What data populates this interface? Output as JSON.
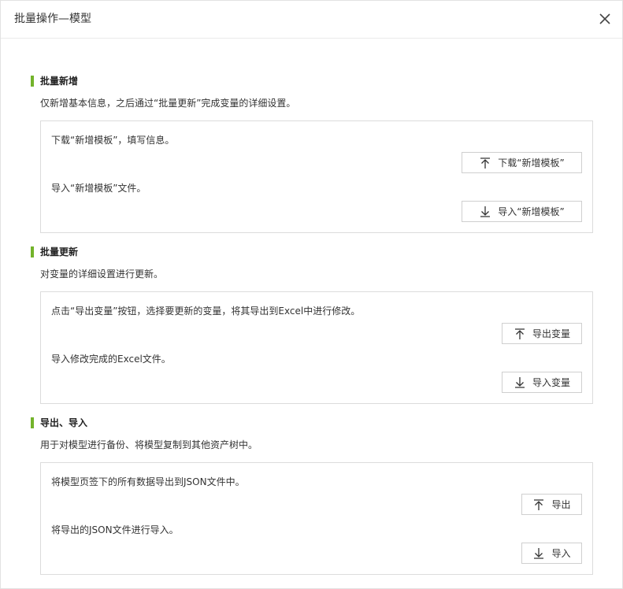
{
  "dialog": {
    "title": "批量操作—模型",
    "close_icon": "close-icon"
  },
  "sections": [
    {
      "title": "批量新增",
      "description": "仅新增基本信息，之后通过“批量更新”完成变量的详细设置。",
      "steps": [
        {
          "text": "下载“新增模板”，填写信息。",
          "button": {
            "label": "下载“新增模板”",
            "icon": "upload-arrow-icon"
          }
        },
        {
          "text": "导入“新增模板”文件。",
          "button": {
            "label": "导入“新增模板”",
            "icon": "download-arrow-icon"
          }
        }
      ]
    },
    {
      "title": "批量更新",
      "description": "对变量的详细设置进行更新。",
      "steps": [
        {
          "text": "点击“导出变量”按钮，选择要更新的变量，将其导出到Excel中进行修改。",
          "button": {
            "label": "导出变量",
            "icon": "upload-arrow-icon"
          }
        },
        {
          "text": "导入修改完成的Excel文件。",
          "button": {
            "label": "导入变量",
            "icon": "download-arrow-icon"
          }
        }
      ]
    },
    {
      "title": "导出、导入",
      "description": "用于对模型进行备份、将模型复制到其他资产树中。",
      "steps": [
        {
          "text": "将模型页签下的所有数据导出到JSON文件中。",
          "button": {
            "label": "导出",
            "icon": "upload-arrow-icon"
          }
        },
        {
          "text": "将导出的JSON文件进行导入。",
          "button": {
            "label": "导入",
            "icon": "download-arrow-icon"
          }
        }
      ]
    }
  ],
  "colors": {
    "accent": "#73b32b",
    "border": "#dcdcdc",
    "text": "#333333"
  }
}
